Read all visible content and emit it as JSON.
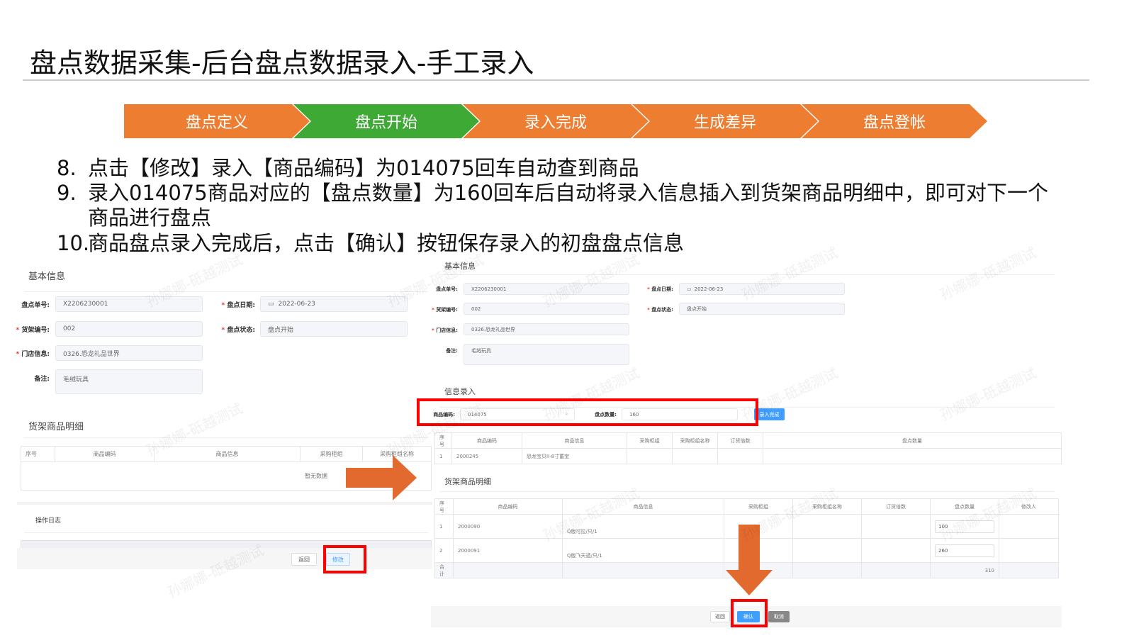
{
  "title": "盘点数据采集-后台盘点数据录入-手工录入",
  "steps": [
    {
      "label": "盘点定义",
      "color": "#ED7D31"
    },
    {
      "label": "盘点开始",
      "color": "#3EA935"
    },
    {
      "label": "录入完成",
      "color": "#ED7D31"
    },
    {
      "label": "生成差异",
      "color": "#ED7D31"
    },
    {
      "label": "盘点登帐",
      "color": "#ED7D31"
    }
  ],
  "instructions": [
    {
      "num": "8.",
      "text": "点击【修改】录入【商品编码】为014075回车自动查到商品"
    },
    {
      "num": "9.",
      "text": "录入014075商品对应的【盘点数量】为160回车后自动将录入信息插入到货架商品明细中，即可对下一个",
      "text2": "商品进行盘点"
    },
    {
      "num": "10.",
      "text": "商品盘点录入完成后，点击【确认】按钮保存录入的初盘盘点信息"
    }
  ],
  "watermark": "孙娜娜-砥越测试",
  "form": {
    "section": "基本信息",
    "order_no_label": "盘点单号:",
    "order_no": "X2206230001",
    "date_label": "盘点日期:",
    "date": "2022-06-23",
    "shelf_label": "货架编号:",
    "shelf": "002",
    "status_label": "盘点状态:",
    "status": "盘点开始",
    "store_label": "门店信息:",
    "store": "0326.恐龙礼品世界",
    "remark_label": "备注:",
    "remark": "毛绒玩具"
  },
  "left": {
    "detail_section": "货架商品明细",
    "columns": [
      "序号",
      "商品编码",
      "商品信息",
      "采购柜组",
      "采购柜组名称"
    ],
    "empty": "暂无数据",
    "log_section": "操作日志",
    "back_button": "返回",
    "edit_button": "修改"
  },
  "entry": {
    "section": "信息录入",
    "code_label": "商品编码:",
    "code": "014075",
    "qty_label": "盘点数量:",
    "qty": "160",
    "done_button": "录入完成",
    "columns": [
      "序号",
      "商品编码",
      "商品信息",
      "采购柜组",
      "采购柜组名称",
      "订货倍数",
      "盘点数量"
    ],
    "row": {
      "no": "1",
      "code": "2000245",
      "info": "恐龙宝贝II-8寸蓄宝"
    }
  },
  "detail": {
    "section": "货架商品明细",
    "columns": [
      "序号",
      "商品编码",
      "商品信息",
      "采购柜组",
      "采购柜组名称",
      "订货倍数",
      "盘点数量",
      "修改人"
    ],
    "rows": [
      {
        "no": "1",
        "code": "2000090",
        "info": "Q版可拉/只/1",
        "qty": "100"
      },
      {
        "no": "2",
        "code": "2000091",
        "info": "Q版飞天遁/只/1",
        "qty": "260"
      }
    ],
    "total_label": "合计",
    "total": "310",
    "back_button": "返回",
    "confirm_button": "确认",
    "cancel_button": "取消"
  }
}
